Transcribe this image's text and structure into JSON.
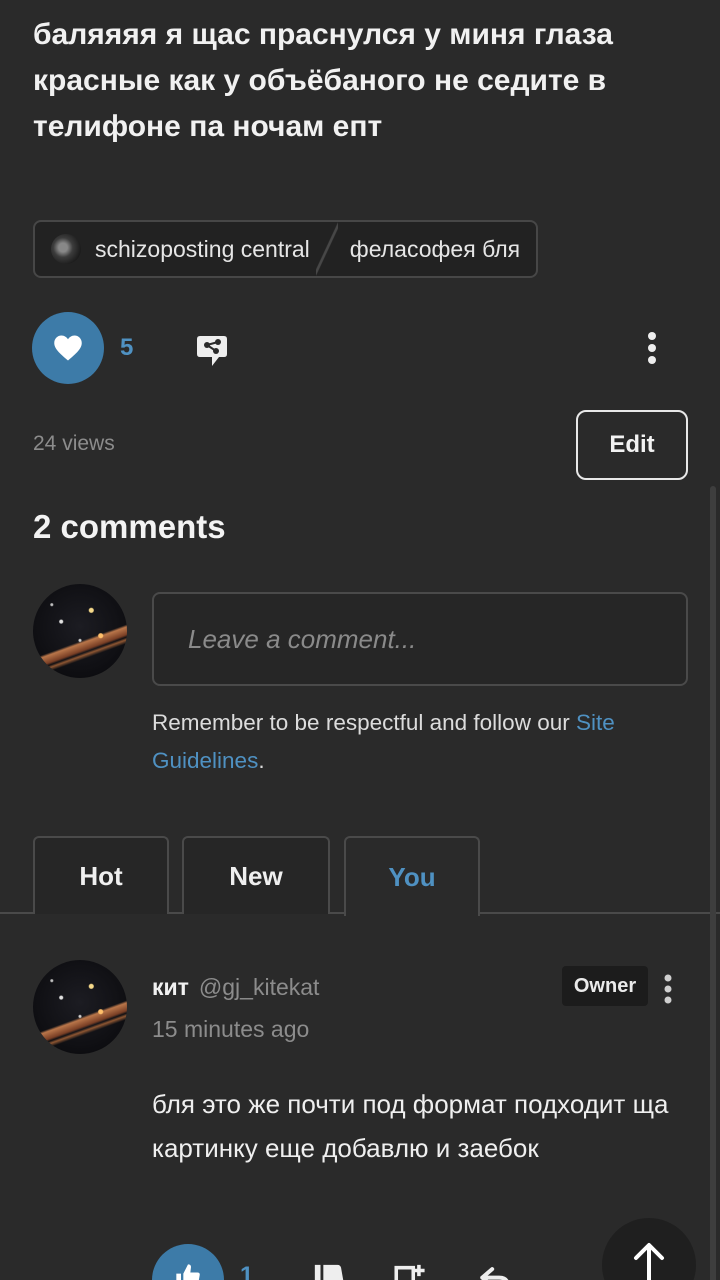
{
  "post": {
    "text": "баляяяя я щас праснулся у миня глаза красные как у объёбаного не седите в телифоне па ночам епт",
    "community": "schizoposting central",
    "topic": "феласофея бля",
    "like_count": "5",
    "views": "24 views",
    "edit_label": "Edit"
  },
  "comments": {
    "title": "2 comments",
    "input_placeholder": "Leave a comment...",
    "guidelines_text": "Remember to be respectful and follow our ",
    "guidelines_link": "Site Guidelines",
    "guidelines_end": ".",
    "tabs": [
      {
        "label": "Hot",
        "active": false
      },
      {
        "label": "New",
        "active": false
      },
      {
        "label": "You",
        "active": true
      }
    ],
    "items": [
      {
        "name": "кит",
        "handle": "@gj_kitekat",
        "time": "15 minutes ago",
        "badge": "Owner",
        "body": "бля это же почти под формат подходит ща картинку еще добавлю и заебок",
        "like_count": "1"
      }
    ]
  },
  "icons": {
    "like": "heart-icon",
    "share": "share-icon",
    "more": "kebab-menu-icon",
    "comment_like": "thumbs-up-icon",
    "comment_dislike": "thumbs-down-icon",
    "comment_reply": "reply-icon",
    "scroll_top": "arrow-up-icon"
  },
  "colors": {
    "background": "#2a2a2a",
    "accent": "#3d7ba8",
    "link": "#4f91c2"
  }
}
